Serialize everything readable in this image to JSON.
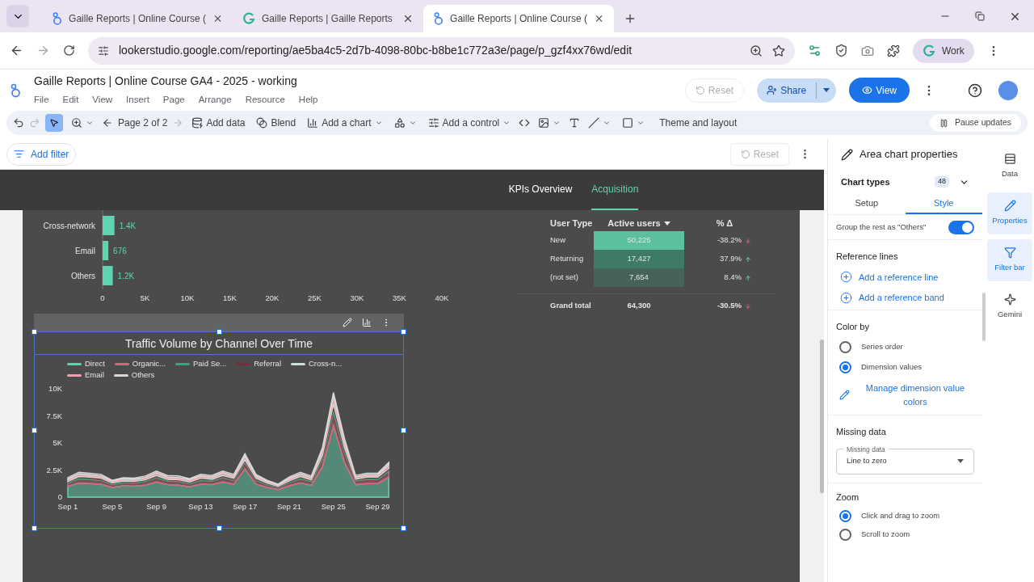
{
  "browser": {
    "tabs": [
      {
        "title": "Gaille Reports | Online Course (",
        "kind": "looker",
        "selected": false
      },
      {
        "title": "Gaille Reports | Gaille Reports",
        "kind": "gaille",
        "selected": false
      },
      {
        "title": "Gaille Reports | Online Course (",
        "kind": "looker",
        "selected": true
      }
    ],
    "url": "lookerstudio.google.com/reporting/ae5ba4c5-2d7b-4098-80bc-b8be1c772a3e/page/p_gzf4xx76wd/edit",
    "profile": "Work"
  },
  "app": {
    "title": "Gaille Reports | Online Course GA4 - 2025 - working",
    "menu": [
      "File",
      "Edit",
      "View",
      "Insert",
      "Page",
      "Arrange",
      "Resource",
      "Help"
    ],
    "reset": {
      "label": "Reset",
      "disabled": true
    },
    "share": "Share",
    "view": "View"
  },
  "toolbar": {
    "page": "Page 2 of 2",
    "add_data": "Add data",
    "blend": "Blend",
    "add_chart": "Add a chart",
    "add_control": "Add a control",
    "theme": "Theme and layout",
    "pause": "Pause updates"
  },
  "filter_bar": {
    "add_filter": "Add filter",
    "reset": {
      "label": "Reset",
      "disabled": true
    }
  },
  "report": {
    "tabs": [
      {
        "label": "KPIs Overview",
        "selected": false
      },
      {
        "label": "Acquisition",
        "selected": true
      }
    ],
    "bar_chart": {
      "chart_data": {
        "type": "bar",
        "orientation": "horizontal",
        "categories": [
          "Cross-network",
          "Email",
          "Others"
        ],
        "values": [
          1400,
          676,
          1200
        ],
        "value_labels": [
          "1.4K",
          "676",
          "1.2K"
        ],
        "xlim": [
          0,
          40000
        ],
        "xticks": [
          {
            "value": 0,
            "label": "0"
          },
          {
            "value": 5000,
            "label": "5K"
          },
          {
            "value": 10000,
            "label": "10K"
          },
          {
            "value": 15000,
            "label": "15K"
          },
          {
            "value": 20000,
            "label": "20K"
          },
          {
            "value": 25000,
            "label": "25K"
          },
          {
            "value": 30000,
            "label": "30K"
          },
          {
            "value": 35000,
            "label": "35K"
          },
          {
            "value": 40000,
            "label": "40K"
          }
        ]
      }
    },
    "table": {
      "columns": [
        "User Type",
        "Active users",
        "% Δ"
      ],
      "rows": [
        {
          "user_type": "New",
          "active_users": "50,225",
          "delta": "-38.2%",
          "kind": "down",
          "color": "#5cbf9d"
        },
        {
          "user_type": "Returning",
          "active_users": "17,427",
          "delta": "37.9%",
          "kind": "up",
          "color": "#3f7a69"
        },
        {
          "user_type": "(not set)",
          "active_users": "7,654",
          "delta": "8.4%",
          "kind": "up",
          "color": "#46625a"
        }
      ],
      "total": {
        "label": "Grand total",
        "active_users": "64,300",
        "delta": "-30.5%",
        "kind": "down"
      }
    },
    "area_chart": {
      "chart_data": {
        "type": "area",
        "stacked": true,
        "title": "Traffic Volume by Channel Over Time",
        "categories": [
          "Sep 1",
          null,
          null,
          null,
          "Sep 5",
          null,
          null,
          null,
          "Sep 9",
          null,
          null,
          null,
          "Sep 13",
          null,
          null,
          null,
          "Sep 17",
          null,
          null,
          null,
          "Sep 21",
          null,
          null,
          null,
          "Sep 25",
          null,
          null,
          null,
          "Sep 29",
          null
        ],
        "ylim": [
          0,
          10000
        ],
        "yticks": [
          {
            "value": 0,
            "label": "0"
          },
          {
            "value": 2500,
            "label": "2.5K"
          },
          {
            "value": 5000,
            "label": "5K"
          },
          {
            "value": 7500,
            "label": "7.5K"
          },
          {
            "value": 10000,
            "label": "10K"
          }
        ],
        "series": [
          {
            "name": "Direct",
            "color": "#5fd4b0",
            "values": [
              1000,
              1300,
              1250,
              1200,
              900,
              1050,
              1000,
              1100,
              1400,
              1150,
              1100,
              950,
              1200,
              1150,
              1400,
              1200,
              2600,
              1200,
              900,
              700,
              1050,
              1300,
              1100,
              2800,
              6600,
              3200,
              1150,
              1250,
              1250,
              1850
            ]
          },
          {
            "name": "Organic...",
            "color": "#e0607a",
            "values": [
              300,
              400,
              400,
              350,
              250,
              300,
              300,
              350,
              400,
              350,
              350,
              300,
              350,
              350,
              400,
              350,
              600,
              350,
              250,
              200,
              300,
              400,
              350,
              700,
              1300,
              900,
              350,
              400,
              400,
              550
            ]
          },
          {
            "name": "Paid Se...",
            "color": "#3aa37f",
            "values": [
              100,
              100,
              100,
              100,
              100,
              100,
              100,
              100,
              100,
              100,
              100,
              100,
              100,
              100,
              100,
              100,
              150,
              100,
              100,
              50,
              100,
              100,
              100,
              200,
              400,
              250,
              100,
              100,
              100,
              150
            ]
          },
          {
            "name": "Referral",
            "color": "#7a2c3c",
            "values": [
              50,
              100,
              100,
              100,
              50,
              50,
              50,
              50,
              100,
              50,
              50,
              50,
              100,
              50,
              100,
              100,
              100,
              100,
              50,
              50,
              50,
              100,
              50,
              150,
              300,
              200,
              50,
              100,
              100,
              100
            ]
          },
          {
            "name": "Cross-n...",
            "color": "#c9e0d6",
            "values": [
              100,
              150,
              100,
              100,
              100,
              100,
              100,
              100,
              150,
              100,
              100,
              100,
              100,
              100,
              150,
              100,
              200,
              100,
              100,
              50,
              100,
              150,
              100,
              250,
              400,
              300,
              100,
              100,
              100,
              200
            ]
          },
          {
            "name": "Email",
            "color": "#f0a0ac",
            "values": [
              100,
              100,
              100,
              100,
              50,
              100,
              100,
              100,
              100,
              100,
              100,
              100,
              100,
              100,
              100,
              100,
              150,
              100,
              50,
              50,
              100,
              100,
              100,
              200,
              350,
              250,
              100,
              100,
              100,
              150
            ]
          },
          {
            "name": "Others",
            "color": "#d8d8d8",
            "values": [
              150,
              150,
              150,
              150,
              100,
              100,
              100,
              150,
              150,
              150,
              150,
              100,
              150,
              150,
              150,
              150,
              200,
              150,
              100,
              100,
              150,
              150,
              150,
              250,
              300,
              300,
              150,
              150,
              150,
              200
            ]
          }
        ]
      }
    }
  },
  "panel": {
    "title": "Area chart properties",
    "chart_types": "Chart types",
    "chart_count": "48",
    "tabs": [
      {
        "label": "Setup",
        "selected": false
      },
      {
        "label": "Style",
        "selected": true
      }
    ],
    "group_others": {
      "label": "Group the rest as \"Others\"",
      "on": true
    },
    "reference_lines": {
      "heading": "Reference lines",
      "actions": [
        "Add a reference line",
        "Add a reference band"
      ]
    },
    "color_by": {
      "heading": "Color by",
      "options": [
        {
          "label": "Series order",
          "selected": false
        },
        {
          "label": "Dimension values",
          "selected": true
        }
      ],
      "manage": "Manage dimension value colors"
    },
    "missing_data": {
      "heading": "Missing data",
      "field_label": "Missing data",
      "value": "Line to zero"
    },
    "zoom": {
      "heading": "Zoom",
      "options": [
        {
          "label": "Click and drag to zoom",
          "selected": true
        },
        {
          "label": "Scroll to zoom",
          "selected": false
        }
      ]
    }
  },
  "rail": [
    {
      "label": "Data",
      "kind": "data",
      "selected": false
    },
    {
      "label": "Properties",
      "kind": "properties",
      "selected": true
    },
    {
      "label": "Filter bar",
      "kind": "filter",
      "selected": true
    },
    {
      "label": "Gemini",
      "kind": "gemini",
      "selected": false
    }
  ]
}
